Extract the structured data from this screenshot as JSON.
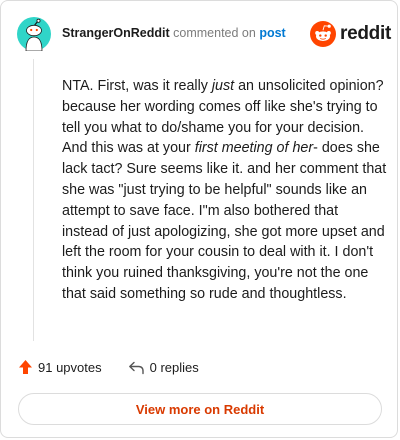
{
  "header": {
    "username": "StrangerOnReddit",
    "action_text": "commented on",
    "post_link": "post",
    "logo_word": "reddit"
  },
  "comment": {
    "seg1": "NTA. First, was it really ",
    "em1": "just",
    "seg2": " an unsolicited opinion? because her wording comes off like she's trying to tell you what to do/shame you for your decision. And this was at your ",
    "em2": "first meeting of her",
    "seg3": "- does she lack tact? Sure seems like it. and her comment that she was \"just trying to be helpful\" sounds like an attempt to save face. I\"m also bothered that instead of just apologizing, she got more upset and left the room for your cousin to deal with it. I don't think you ruined thanksgiving, you're not the one that said something so rude and thoughtless."
  },
  "actions": {
    "upvotes": "91 upvotes",
    "replies": "0 replies"
  },
  "footer": {
    "view_more": "View more on Reddit"
  },
  "colors": {
    "brand": "#ff4500",
    "link": "#0079d3",
    "view_more": "#d93a00",
    "avatar": "#30d5c8"
  },
  "icons": {
    "avatar": "snoo-avatar-icon",
    "logo": "reddit-snoo-icon",
    "upvote": "upvote-arrow-icon",
    "reply": "reply-arrow-icon"
  }
}
